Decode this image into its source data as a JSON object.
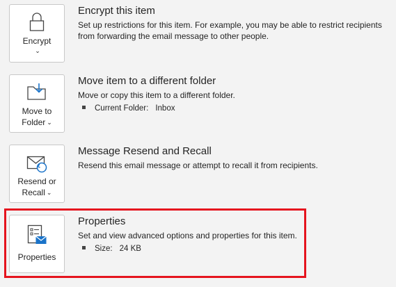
{
  "encrypt": {
    "title": "Encrypt this item",
    "description": "Set up restrictions for this item. For example, you may be able to restrict recipients from forwarding the email message to other people.",
    "button_label": "Encrypt",
    "icon": "lock-icon"
  },
  "move": {
    "title": "Move item to a different folder",
    "description": "Move or copy this item to a different folder.",
    "button_line1": "Move to",
    "button_line2": "Folder",
    "icon": "folder-move-icon",
    "bullet_label": "Current Folder:",
    "bullet_value": "Inbox"
  },
  "resend": {
    "title": "Message Resend and Recall",
    "description": "Resend this email message or attempt to recall it from recipients.",
    "button_line1": "Resend or",
    "button_line2": "Recall",
    "icon": "envelope-resend-icon"
  },
  "properties": {
    "title": "Properties",
    "description": "Set and view advanced options and properties for this item.",
    "button_label": "Properties",
    "icon": "properties-icon",
    "bullet_label": "Size:",
    "bullet_value": "24 KB"
  },
  "colors": {
    "highlight": "#e5141e",
    "icon_blue": "#1a73c9"
  }
}
